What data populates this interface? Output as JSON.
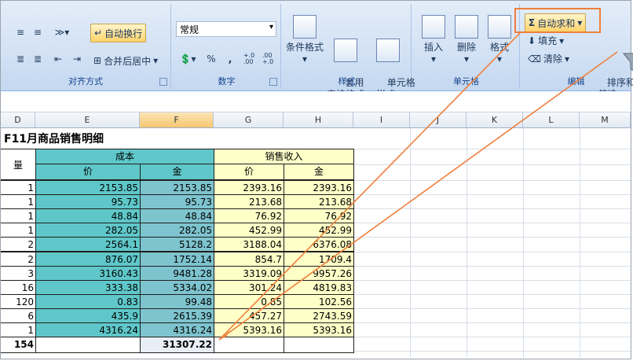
{
  "ribbon": {
    "alignment": {
      "wrap_text": "自动换行",
      "merge_center": "合并后居中",
      "label": "对齐方式"
    },
    "number": {
      "format": "常规",
      "percent": "%",
      "comma": ",",
      "dec_inc": "+.0\n.00",
      "dec_dec": ".00\n+.0",
      "label": "数字"
    },
    "styles": {
      "conditional": "条件格式",
      "table": "套用\n表格格式",
      "cell": "单元格\n样式",
      "label": "样式"
    },
    "cells": {
      "insert": "插入",
      "delete": "删除",
      "format": "格式",
      "label": "单元格"
    },
    "editing": {
      "autosum": "自动求和",
      "fill": "填充",
      "clear": "清除",
      "sort": "排序和\n筛选",
      "label": "编辑",
      "sigma": "Σ"
    }
  },
  "sheet": {
    "columns": [
      "D",
      "E",
      "F",
      "G",
      "H",
      "I",
      "J",
      "K",
      "L",
      "M"
    ],
    "title": "F11月商品销售明细",
    "header": {
      "qty": "量",
      "cost": "成本",
      "revenue": "销售收入",
      "price": "价",
      "amount": "金"
    },
    "rows": [
      {
        "qty": "1",
        "cost_price": "2153.85",
        "cost_amount": "2153.85",
        "rev_price": "2393.16",
        "rev_amount": "2393.16"
      },
      {
        "qty": "1",
        "cost_price": "95.73",
        "cost_amount": "95.73",
        "rev_price": "213.68",
        "rev_amount": "213.68"
      },
      {
        "qty": "1",
        "cost_price": "48.84",
        "cost_amount": "48.84",
        "rev_price": "76.92",
        "rev_amount": "76.92"
      },
      {
        "qty": "1",
        "cost_price": "282.05",
        "cost_amount": "282.05",
        "rev_price": "452.99",
        "rev_amount": "452.99"
      },
      {
        "qty": "2",
        "cost_price": "2564.1",
        "cost_amount": "5128.2",
        "rev_price": "3188.04",
        "rev_amount": "6376.08"
      },
      {
        "qty": "2",
        "cost_price": "876.07",
        "cost_amount": "1752.14",
        "rev_price": "854.7",
        "rev_amount": "1709.4"
      },
      {
        "qty": "3",
        "cost_price": "3160.43",
        "cost_amount": "9481.28",
        "rev_price": "3319.09",
        "rev_amount": "9957.26"
      },
      {
        "qty": "16",
        "cost_price": "333.38",
        "cost_amount": "5334.02",
        "rev_price": "301.24",
        "rev_amount": "4819.83"
      },
      {
        "qty": "120",
        "cost_price": "0.83",
        "cost_amount": "99.48",
        "rev_price": "0.85",
        "rev_amount": "102.56"
      },
      {
        "qty": "6",
        "cost_price": "435.9",
        "cost_amount": "2615.39",
        "rev_price": "457.27",
        "rev_amount": "2743.59"
      },
      {
        "qty": "1",
        "cost_price": "4316.24",
        "cost_amount": "4316.24",
        "rev_price": "5393.16",
        "rev_amount": "5393.16"
      }
    ],
    "total": {
      "qty": "154",
      "cost_amount": "31307.22"
    }
  },
  "colors": {
    "teal": "#5fc7c9",
    "teal_selected": "#7ec4cf",
    "yellow": "#ffffc8",
    "callout": "#f07f3c"
  }
}
